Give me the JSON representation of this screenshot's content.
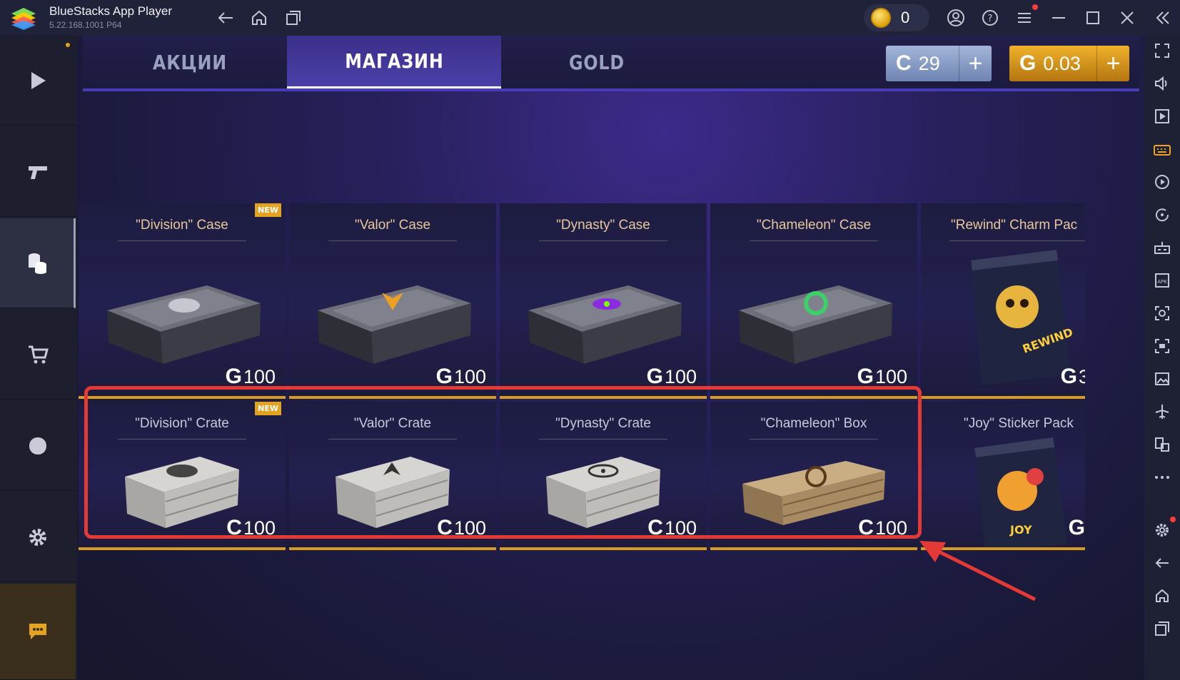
{
  "window": {
    "app_title": "BlueStacks App Player",
    "app_version": "5.22.168.1001  P64",
    "coins": "0",
    "icons": [
      "back-icon",
      "home-icon",
      "multi-instance-icon",
      "account-icon",
      "help-icon",
      "menu-icon",
      "minimize-icon",
      "maximize-icon",
      "close-icon",
      "collapse-sidebar-icon"
    ]
  },
  "left_sidebar": {
    "items": [
      "play-icon",
      "pistol-icon",
      "coins-icon",
      "cart-icon",
      "clan-icon",
      "settings-gear-icon",
      "chat-icon"
    ]
  },
  "right_sidebar": {
    "items": [
      "fullscreen-icon",
      "volume-icon",
      "media-icon",
      "keyboard-icon",
      "macro-icon",
      "rotate-icon",
      "game-controls-icon",
      "apk-icon",
      "screenshot-icon",
      "record-icon",
      "gallery-icon",
      "airplane-icon",
      "multi-window-icon",
      "more-icon",
      "settings-icon",
      "back-icon",
      "home-icon",
      "recent-apps-icon"
    ]
  },
  "tabs": [
    {
      "label": "АКЦИИ",
      "active": false
    },
    {
      "label": "МАГАЗИН",
      "active": true
    },
    {
      "label": "GOLD",
      "active": false
    }
  ],
  "currency": {
    "silver_symbol": "C",
    "silver": "29",
    "gold_symbol": "G",
    "gold": "0.03",
    "plus": "+"
  },
  "items_row1": [
    {
      "name": "\"Division\" Case",
      "symbol": "G",
      "price": "100",
      "badge": "NEW"
    },
    {
      "name": "\"Valor\" Case",
      "symbol": "G",
      "price": "100",
      "badge": ""
    },
    {
      "name": "\"Dynasty\" Case",
      "symbol": "G",
      "price": "100",
      "badge": ""
    },
    {
      "name": "\"Chameleon\" Case",
      "symbol": "G",
      "price": "100",
      "badge": ""
    },
    {
      "name": "\"Rewind\" Charm Pac",
      "symbol": "G",
      "price": "3",
      "badge": ""
    }
  ],
  "items_row2": [
    {
      "name": "\"Division\" Crate",
      "symbol": "C",
      "price": "100",
      "badge": "NEW"
    },
    {
      "name": "\"Valor\" Crate",
      "symbol": "C",
      "price": "100",
      "badge": ""
    },
    {
      "name": "\"Dynasty\" Crate",
      "symbol": "C",
      "price": "100",
      "badge": ""
    },
    {
      "name": "\"Chameleon\" Box",
      "symbol": "C",
      "price": "100",
      "badge": ""
    },
    {
      "name": "\"Joy\" Sticker Pack",
      "symbol": "G",
      "price": "",
      "badge": ""
    }
  ],
  "colors": {
    "accent_gold": "#d79a23",
    "highlight_red": "#e53935",
    "tab_active": "#4a3fa8"
  }
}
